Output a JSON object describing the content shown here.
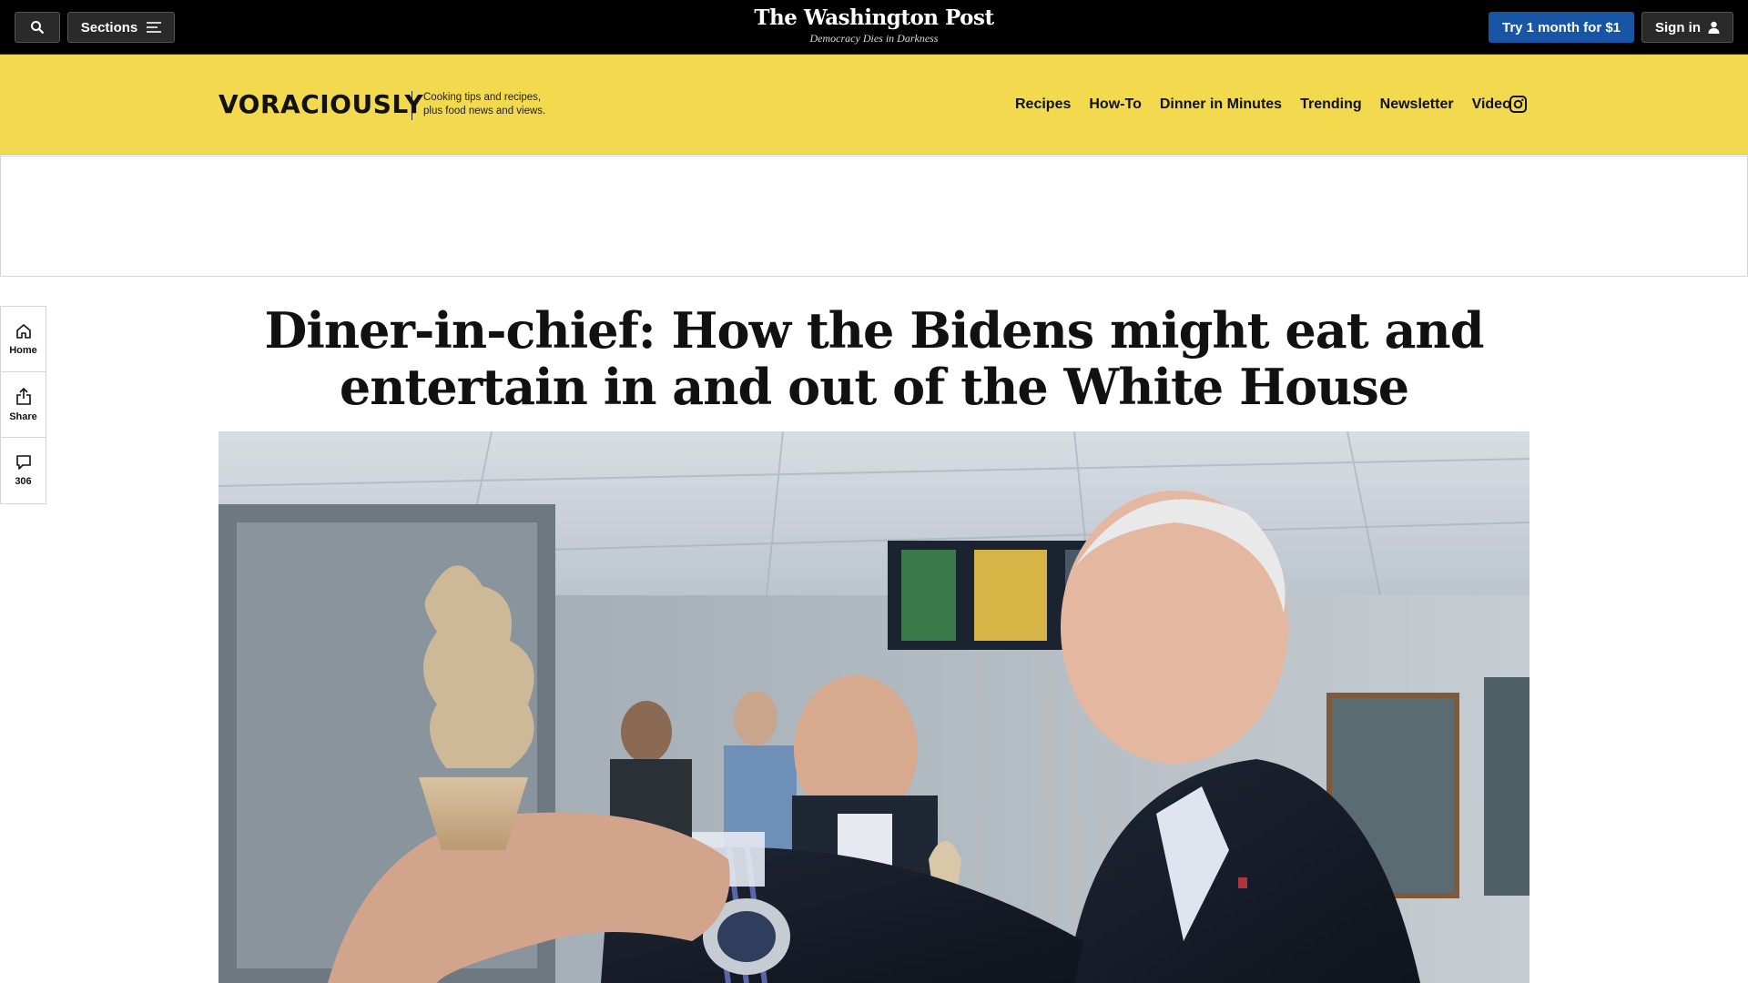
{
  "topbar": {
    "sections_label": "Sections",
    "masthead_title": "The Washington Post",
    "masthead_tagline": "Democracy Dies in Darkness",
    "try_label": "Try 1 month for $1",
    "signin_label": "Sign in",
    "colors": {
      "background": "#000000",
      "try_button": "#1955a5"
    }
  },
  "section_header": {
    "logo": "VORACIOUSLY",
    "tagline_line1": "Cooking tips and recipes,",
    "tagline_line2": "plus food news and views.",
    "nav": [
      "Recipes",
      "How-To",
      "Dinner in Minutes",
      "Trending",
      "Newsletter",
      "Video"
    ],
    "instagram_icon": "instagram-icon",
    "background_color": "#f2d94e"
  },
  "rail": {
    "home_label": "Home",
    "share_label": "Share",
    "comments_count": "306"
  },
  "article": {
    "headline": "Diner-in-chief: How the Bidens might eat and entertain in and out of the White House"
  }
}
